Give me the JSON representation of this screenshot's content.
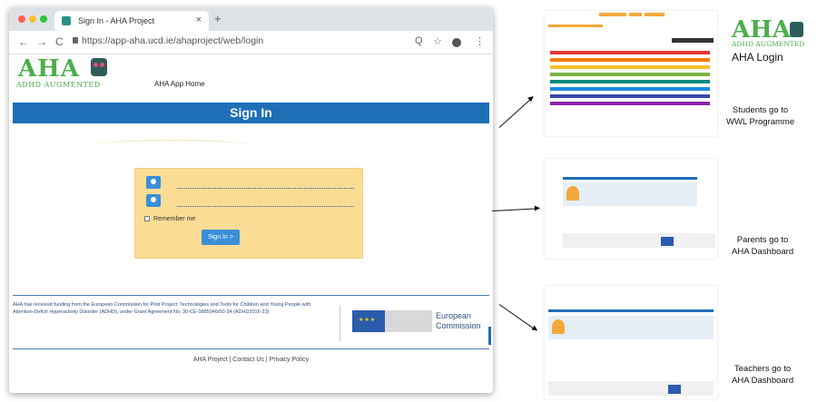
{
  "browser": {
    "tab_title": "Sign In - AHA Project",
    "tab_close": "×",
    "new_tab": "+",
    "url": "https://app-aha.ucd.ie/ahaproject/web/login",
    "nav_back": "←",
    "nav_forward": "→",
    "nav_reload": "C",
    "tool_search": "Q",
    "tool_star": "☆",
    "tool_menu": "⋮"
  },
  "page": {
    "logo_text": "AHA",
    "logo_subtitle": "ADHD AUGMENTED",
    "app_home": "AHA App Home",
    "signin_title": "Sign In",
    "remember_me": "Remember me",
    "signin_button": "Sign In >",
    "funding_text": "AHA has received funding from the European Commission for Pilot Project: Technologies and Tools for Children and Young People with Attention-Deficit Hyperactivity Disorder (ADHD), under Grant Agreement No. 30-CE-0885046/00-34 (ADHD2016-23)",
    "eu_text_1": "European",
    "eu_text_2": "Commission",
    "footer_links": "AHA Project | Contact Us | Privacy Policy"
  },
  "annotations": {
    "logo_text": "AHA",
    "logo_subtitle": "ADHD AUGMENTED",
    "login_caption": "AHA Login",
    "students_caption_1": "Students go to",
    "students_caption_2": "WWL Programme",
    "parents_caption_1": "Parents go to",
    "parents_caption_2": "AHA Dashboard",
    "teachers_caption_1": "Teachers go to",
    "teachers_caption_2": "AHA Dashboard"
  }
}
